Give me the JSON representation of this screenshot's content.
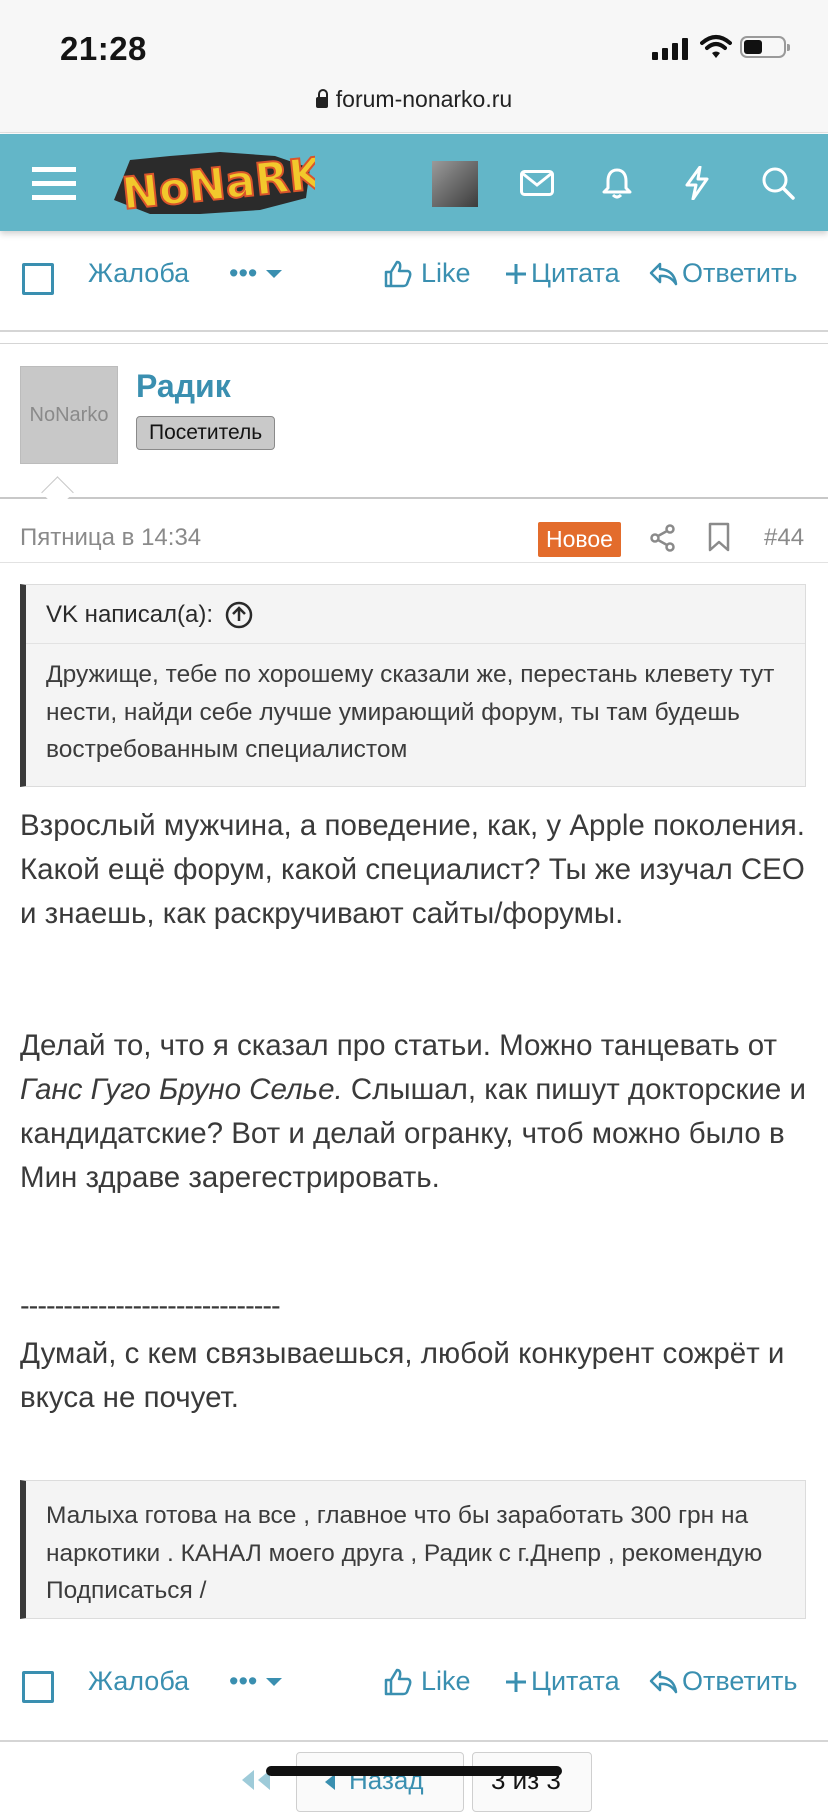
{
  "status_bar": {
    "time": "21:28"
  },
  "browser": {
    "url": "forum-nonarko.ru"
  },
  "nav": {
    "logo_text": "NoNarko"
  },
  "top_actions": {
    "report": "Жалоба",
    "more": "•••",
    "like": "Like",
    "quote": "Цитата",
    "reply": "Ответить"
  },
  "post": {
    "avatar_text": "NoNarko",
    "username": "Радик",
    "user_title": "Посетитель",
    "date": "Пятница в 14:34",
    "new_badge": "Новое",
    "number": "#44",
    "quote": {
      "author": "VK написал(а):",
      "text": "Дружище, тебе по хорошему сказали же, перестань клевету тут нести, найди себе лучше умирающий форум, ты там будешь востребованным специалистом"
    },
    "paragraph1": "Взрослый мужчина, а поведение, как, у Apple поколения. Какой ещё форум, какой специалист? Ты же изучал СЕО и знаешь, как раскручивают сайты/форумы.",
    "paragraph2_before": "Делай то, что я сказал про статьи. Можно танцевать от ",
    "paragraph2_italic": "Ганс Гуго Бруно Селье.",
    "paragraph2_after": " Слышал, как пишут докторские и кандидатские? Вот и делай огранку, чтоб можно было в Мин здраве зарегестрировать.",
    "separator": "------------------------------",
    "signature_line": "Думай, с кем связываешься, любой конкурент сожрёт и вкуса не почует.",
    "signature_quote": "Малыха готова на все , главное что бы заработать 300 грн на наркотики . КАНАЛ моего друга , Радик с г.Днепр , рекомендую Подписаться /"
  },
  "bottom_actions": {
    "report": "Жалоба",
    "more": "•••",
    "like": "Like",
    "quote": "Цитата",
    "reply": "Ответить"
  },
  "pagination": {
    "back": "Назад",
    "page_status": "3 из 3"
  },
  "colors": {
    "navbar": "#63b6c8",
    "link": "#3a8fb0",
    "new_badge": "#e36c2c"
  }
}
